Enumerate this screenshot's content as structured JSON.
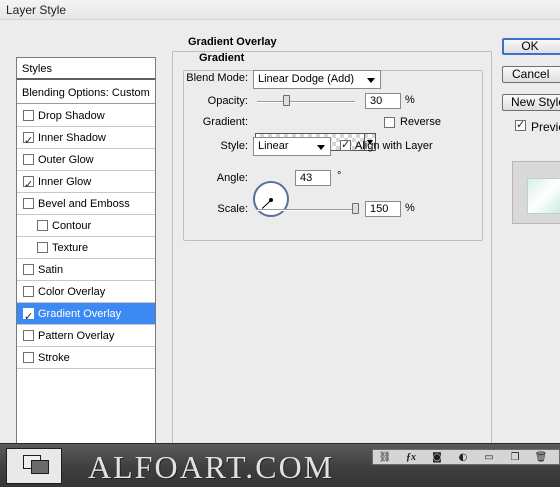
{
  "window": {
    "title": "Layer Style"
  },
  "styles_list": {
    "items": [
      {
        "label": "Styles",
        "type": "header"
      },
      {
        "label": "Blending Options: Custom",
        "type": "header"
      },
      {
        "label": "Drop Shadow",
        "checked": false
      },
      {
        "label": "Inner Shadow",
        "checked": true
      },
      {
        "label": "Outer Glow",
        "checked": false
      },
      {
        "label": "Inner Glow",
        "checked": true
      },
      {
        "label": "Bevel and Emboss",
        "checked": false
      },
      {
        "label": "Contour",
        "checked": false,
        "sub": true
      },
      {
        "label": "Texture",
        "checked": false,
        "sub": true
      },
      {
        "label": "Satin",
        "checked": false
      },
      {
        "label": "Color Overlay",
        "checked": false
      },
      {
        "label": "Gradient Overlay",
        "checked": true,
        "selected": true
      },
      {
        "label": "Pattern Overlay",
        "checked": false
      },
      {
        "label": "Stroke",
        "checked": false
      }
    ]
  },
  "gradient_overlay": {
    "section_title": "Gradient Overlay",
    "group_title": "Gradient",
    "blend_mode": {
      "label": "Blend Mode:",
      "value": "Linear Dodge (Add)"
    },
    "opacity": {
      "label": "Opacity:",
      "value": "30",
      "unit": "%",
      "level_percent": 30
    },
    "gradient": {
      "label": "Gradient:",
      "reverse_label": "Reverse",
      "reverse_checked": false
    },
    "style": {
      "label": "Style:",
      "value": "Linear",
      "align_label": "Align with Layer",
      "align_checked": true
    },
    "angle": {
      "label": "Angle:",
      "value": "43",
      "unit": "°",
      "degrees": 43
    },
    "scale": {
      "label": "Scale:",
      "value": "150",
      "unit": "%",
      "level_percent": 150,
      "max_percent": 150
    }
  },
  "buttons": {
    "ok": "OK",
    "cancel": "Cancel",
    "new_style": "New Style...",
    "preview_label": "Preview",
    "preview_checked": true
  },
  "taskbar": {
    "watermark": "ALFOART.COM",
    "icons": [
      "link-icon",
      "fx-icon",
      "mask-icon",
      "adjustment-icon",
      "folder-icon",
      "new-layer-icon",
      "trash-icon"
    ]
  }
}
